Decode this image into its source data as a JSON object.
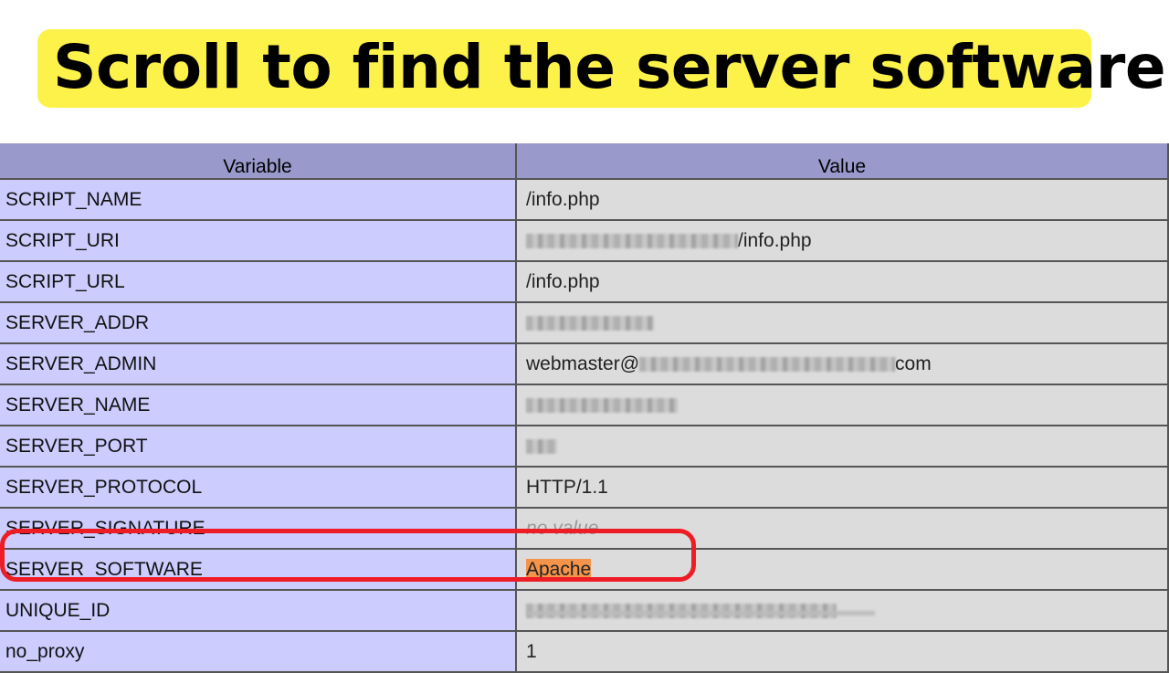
{
  "banner": {
    "text": "Scroll to find the server software"
  },
  "table": {
    "headers": {
      "variable": "Variable",
      "value": "Value"
    },
    "rows": [
      {
        "variable": "SCRIPT_NAME",
        "value": "/info.php"
      },
      {
        "variable": "SCRIPT_URI",
        "value_suffix": "/info.php"
      },
      {
        "variable": "SCRIPT_URL",
        "value": "/info.php"
      },
      {
        "variable": "SERVER_ADDR"
      },
      {
        "variable": "SERVER_ADMIN",
        "value_prefix": "webmaster@",
        "value_suffix": "com"
      },
      {
        "variable": "SERVER_NAME"
      },
      {
        "variable": "SERVER_PORT"
      },
      {
        "variable": "SERVER_PROTOCOL",
        "value": "HTTP/1.1"
      },
      {
        "variable": "SERVER_SIGNATURE",
        "value": "no value"
      },
      {
        "variable": "SERVER_SOFTWARE",
        "value": "Apache"
      },
      {
        "variable": "UNIQUE_ID"
      },
      {
        "variable": "no_proxy",
        "value": "1"
      }
    ]
  },
  "colors": {
    "banner_bg": "#fdf24a",
    "header_bg": "#9999cc",
    "variable_bg": "#ccccff",
    "value_bg": "#dcdcdc",
    "highlight": "#f4944a",
    "annotation_circle": "#ee1c25"
  }
}
